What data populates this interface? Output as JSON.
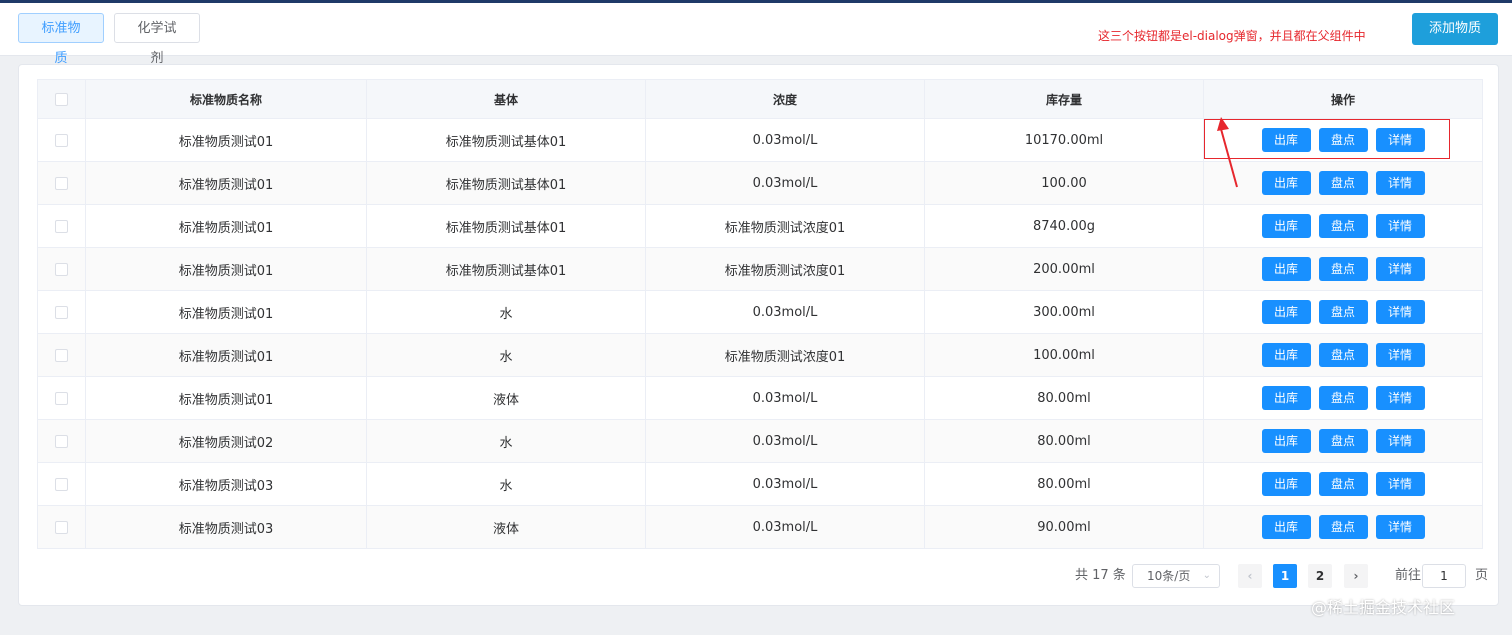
{
  "tabs": [
    {
      "label": "标准物质",
      "active": true
    },
    {
      "label": "化学试剂",
      "active": false
    }
  ],
  "add_button": "添加物质",
  "annotation": "这三个按钮都是el-dialog弹窗，并且都在父组件中",
  "table": {
    "columns": [
      "标准物质名称",
      "基体",
      "浓度",
      "库存量",
      "操作"
    ],
    "rows": [
      [
        "标准物质测试01",
        "标准物质测试基体01",
        "0.03mol/L",
        "10170.00ml"
      ],
      [
        "标准物质测试01",
        "标准物质测试基体01",
        "0.03mol/L",
        "100.00"
      ],
      [
        "标准物质测试01",
        "标准物质测试基体01",
        "标准物质测试浓度01",
        "8740.00g"
      ],
      [
        "标准物质测试01",
        "标准物质测试基体01",
        "标准物质测试浓度01",
        "200.00ml"
      ],
      [
        "标准物质测试01",
        "水",
        "0.03mol/L",
        "300.00ml"
      ],
      [
        "标准物质测试01",
        "水",
        "标准物质测试浓度01",
        "100.00ml"
      ],
      [
        "标准物质测试01",
        "液体",
        "0.03mol/L",
        "80.00ml"
      ],
      [
        "标准物质测试02",
        "水",
        "0.03mol/L",
        "80.00ml"
      ],
      [
        "标准物质测试03",
        "水",
        "0.03mol/L",
        "80.00ml"
      ],
      [
        "标准物质测试03",
        "液体",
        "0.03mol/L",
        "90.00ml"
      ]
    ],
    "actions": [
      "出库",
      "盘点",
      "详情"
    ]
  },
  "pagination": {
    "total_text": "共 17 条",
    "page_size": "10条/页",
    "pages": [
      "1",
      "2"
    ],
    "current": "1",
    "goto_label": "前往",
    "goto_value": "1",
    "page_suffix": "页"
  },
  "watermark": "@稀土掘金技术社区",
  "colors": {
    "primary": "#1890ff",
    "add_button": "#1e9fdb",
    "annotation_red": "#e6272d"
  }
}
